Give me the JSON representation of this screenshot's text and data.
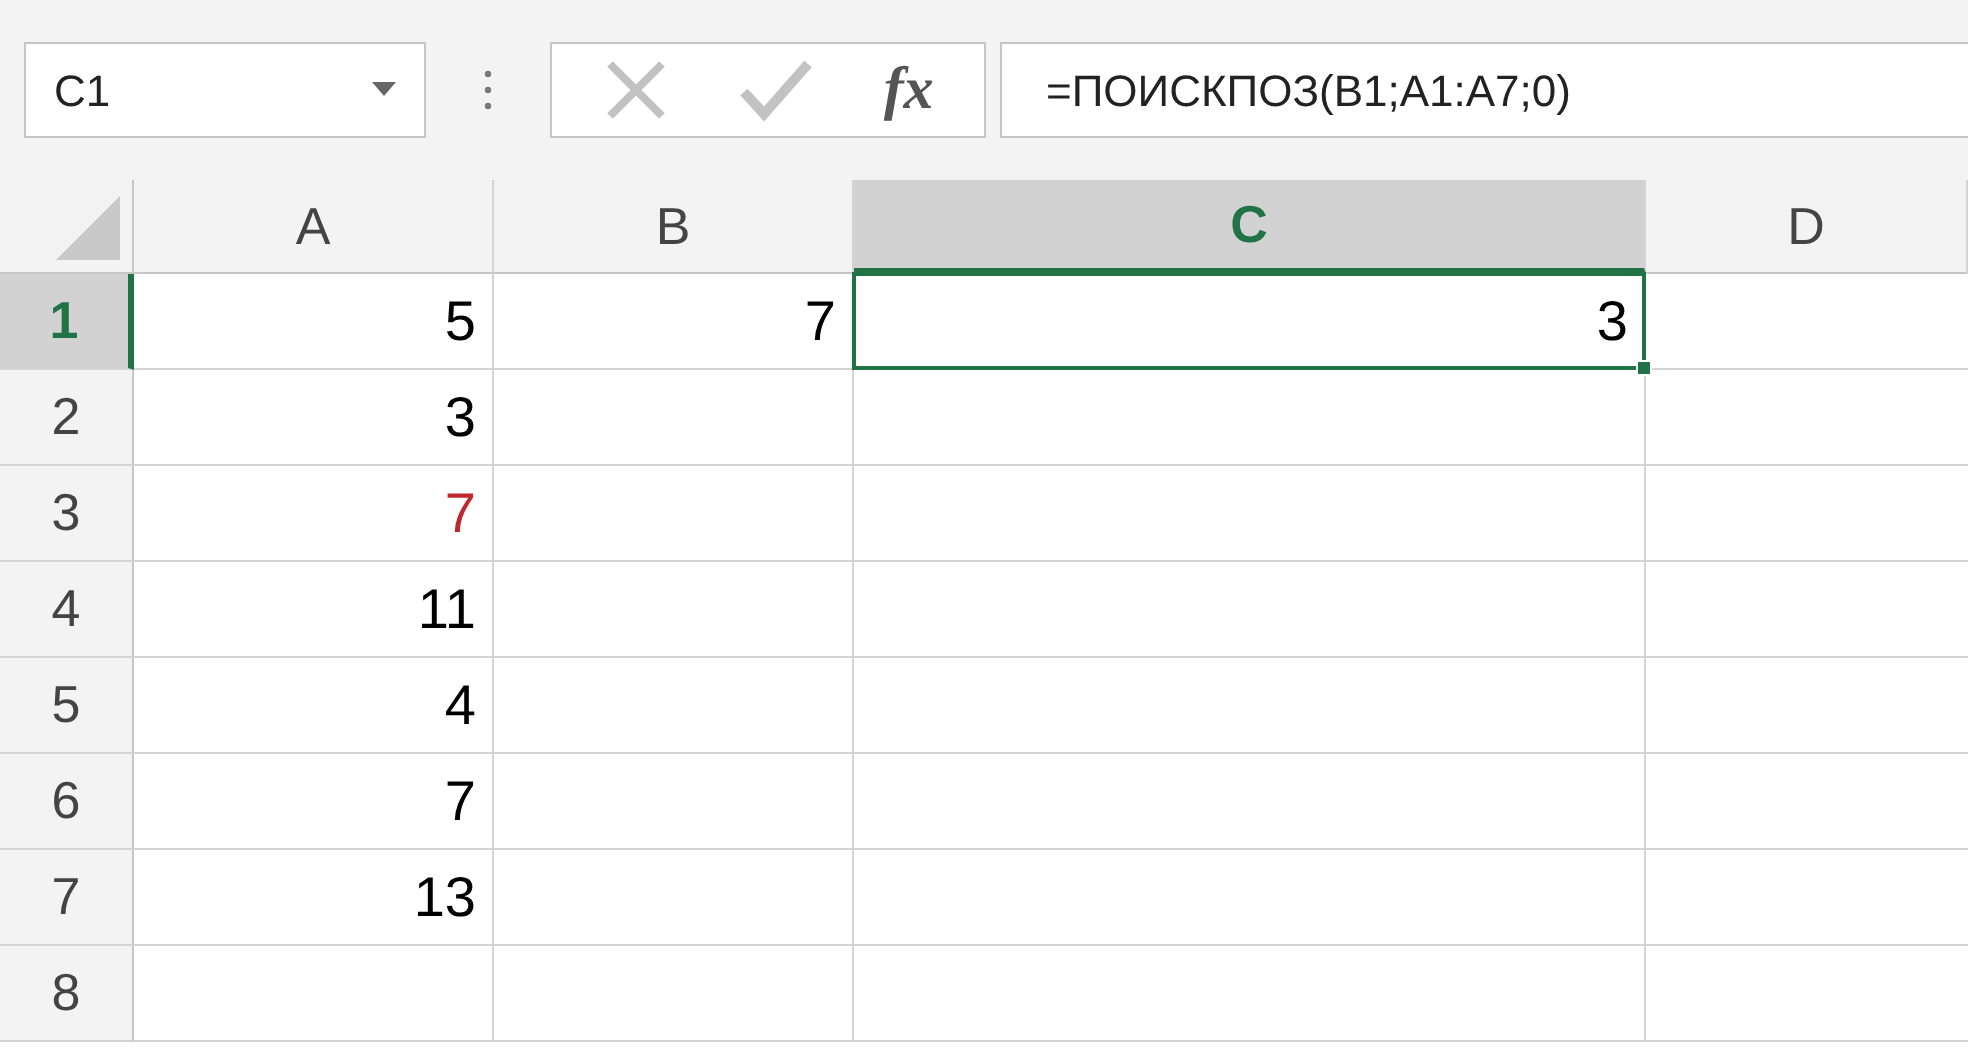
{
  "name_box": {
    "value": "C1"
  },
  "formula_bar": {
    "cancel_disabled": true,
    "enter_disabled": true,
    "function_label": "fx",
    "formula": "=ПОИСКПОЗ(B1;A1:A7;0)"
  },
  "columns": [
    {
      "label": "A",
      "selected": false
    },
    {
      "label": "B",
      "selected": false
    },
    {
      "label": "C",
      "selected": true
    },
    {
      "label": "D",
      "selected": false
    }
  ],
  "rows": [
    {
      "label": "1",
      "selected": true,
      "cells": [
        {
          "value": "5"
        },
        {
          "value": "7"
        },
        {
          "value": "3",
          "selected": true
        }
      ]
    },
    {
      "label": "2",
      "selected": false,
      "cells": [
        {
          "value": "3"
        }
      ]
    },
    {
      "label": "3",
      "selected": false,
      "cells": [
        {
          "value": "7",
          "color": "#c0282d"
        }
      ]
    },
    {
      "label": "4",
      "selected": false,
      "cells": [
        {
          "value": "11"
        }
      ]
    },
    {
      "label": "5",
      "selected": false,
      "cells": [
        {
          "value": "4"
        }
      ]
    },
    {
      "label": "6",
      "selected": false,
      "cells": [
        {
          "value": "7"
        }
      ]
    },
    {
      "label": "7",
      "selected": false,
      "cells": [
        {
          "value": "13"
        }
      ]
    },
    {
      "label": "8",
      "selected": false,
      "cells": []
    }
  ]
}
